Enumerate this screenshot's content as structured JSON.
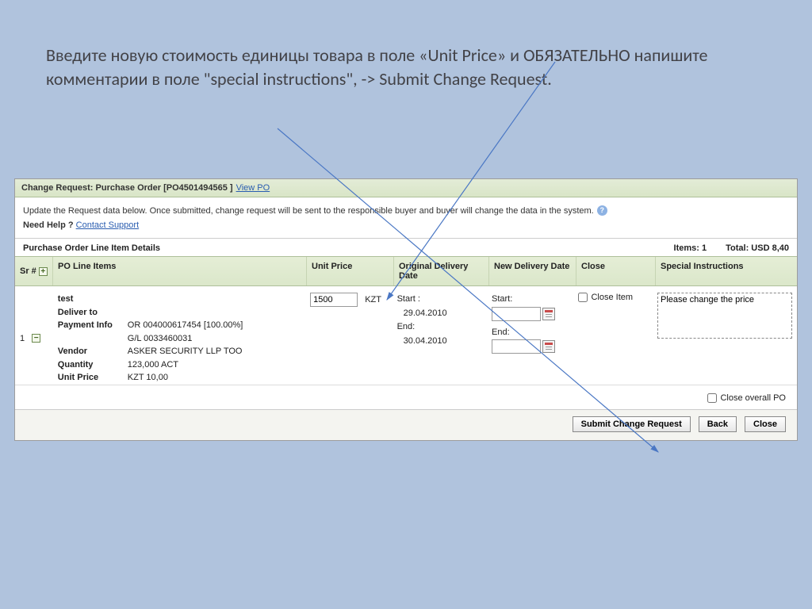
{
  "instruction": "Введите новую стоимость единицы товара в поле «Unit Price»  и  ОБЯЗАТЕЛЬНО напишите комментарии в поле \"special instructions\", -> Submit Change Request.",
  "panel": {
    "title_prefix": "Change Request: Purchase Order [",
    "po_number": "PO4501494565",
    "title_suffix": " ]",
    "view_po_link": "View PO",
    "info_text": "Update the Request data below. Once submitted, change request will be sent to the responsible  buyer and buyer will change the data in the system.",
    "need_help": "Need Help ?",
    "contact_support": "Contact Support"
  },
  "section": {
    "title": "Purchase Order Line Item Details",
    "items_label": "Items:",
    "items_count": "1",
    "total_label": "Total:",
    "total_value": "USD 8,40"
  },
  "columns": {
    "sr": "Sr #",
    "po_line": "PO Line Items",
    "unit_price": "Unit Price",
    "orig_date": "Original Delivery Date",
    "new_date": "New  Delivery Date",
    "close": "Close",
    "spec": "Special Instructions"
  },
  "row": {
    "sr": "1",
    "item_name": "test",
    "deliver_to_label": "Deliver to",
    "payment_info_label": "Payment Info",
    "payment_info_line1": "OR 004000617454 [100.00%]",
    "payment_info_line2": "G/L 0033460031",
    "vendor_label": "Vendor",
    "vendor_value": "ASKER SECURITY LLP TOO",
    "quantity_label": "Quantity",
    "quantity_value": "123,000 ACT",
    "unitprice_label": "Unit Price",
    "unitprice_value": "KZT 10,00",
    "price_input": "1500",
    "currency": "KZT",
    "orig_start_label": "Start :",
    "orig_start_value": "29.04.2010",
    "orig_end_label": "End:",
    "orig_end_value": "30.04.2010",
    "new_start_label": "Start:",
    "new_end_label": "End:",
    "close_item_label": "Close Item",
    "spec_text": "Please change the price"
  },
  "footer": {
    "close_overall_label": "Close overall PO",
    "submit": "Submit Change Request",
    "back": "Back",
    "close": "Close"
  }
}
